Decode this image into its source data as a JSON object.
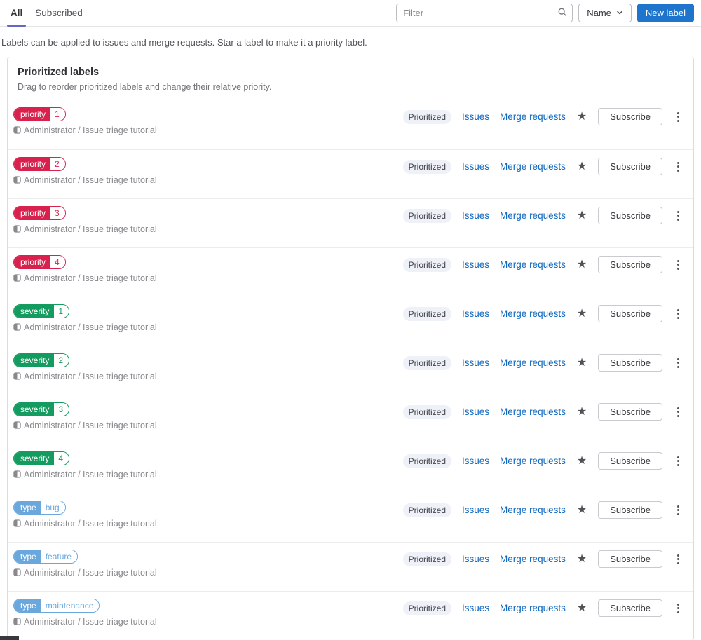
{
  "tabs": [
    {
      "label": "All",
      "active": true
    },
    {
      "label": "Subscribed",
      "active": false
    }
  ],
  "toolbar": {
    "filter_placeholder": "Filter",
    "sort_label": "Name",
    "new_label_button": "New label"
  },
  "description": "Labels can be applied to issues and merge requests. Star a label to make it a priority label.",
  "card": {
    "title": "Prioritized labels",
    "subtitle": "Drag to reorder prioritized labels and change their relative priority."
  },
  "row_common": {
    "project": "Administrator / Issue triage tutorial",
    "prioritized_badge": "Prioritized",
    "issues_link": "Issues",
    "merge_requests_link": "Merge requests",
    "star_icon": "★",
    "subscribe_label": "Subscribe"
  },
  "labels": [
    {
      "scope": "priority",
      "value": "1",
      "color": "#d9214e"
    },
    {
      "scope": "priority",
      "value": "2",
      "color": "#d9214e"
    },
    {
      "scope": "priority",
      "value": "3",
      "color": "#d9214e"
    },
    {
      "scope": "priority",
      "value": "4",
      "color": "#d9214e"
    },
    {
      "scope": "severity",
      "value": "1",
      "color": "#149b5f"
    },
    {
      "scope": "severity",
      "value": "2",
      "color": "#149b5f"
    },
    {
      "scope": "severity",
      "value": "3",
      "color": "#149b5f"
    },
    {
      "scope": "severity",
      "value": "4",
      "color": "#149b5f"
    },
    {
      "scope": "type",
      "value": "bug",
      "color": "#69a7dd"
    },
    {
      "scope": "type",
      "value": "feature",
      "color": "#69a7dd"
    },
    {
      "scope": "type",
      "value": "maintenance",
      "color": "#69a7dd"
    }
  ],
  "colors": {
    "accent_blue": "#1f75cb",
    "link_blue": "#1068bf",
    "tab_indicator": "#6666c4",
    "badge_bg": "#eef1f8",
    "priority_red": "#d9214e",
    "severity_green": "#149b5f",
    "type_blue": "#69a7dd"
  }
}
